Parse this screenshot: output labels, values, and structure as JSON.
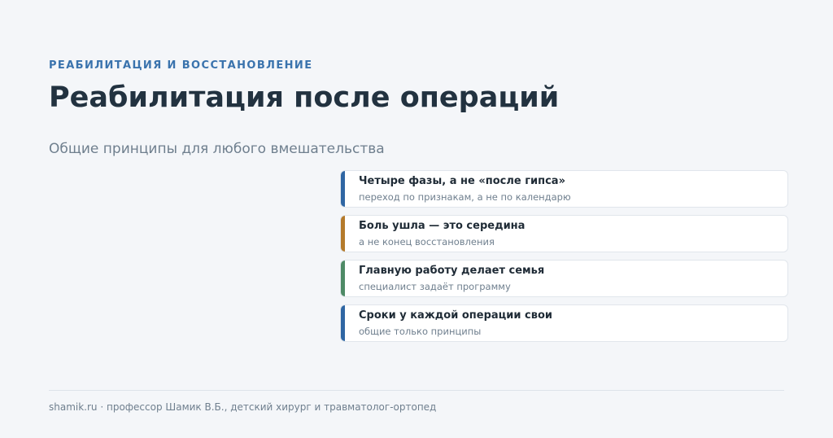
{
  "header": {
    "eyebrow": "РЕАБИЛИТАЦИЯ И ВОССТАНОВЛЕНИЕ",
    "title": "Реабилитация после операций",
    "subtitle": "Общие принципы для любого вмешательства"
  },
  "cards": [
    {
      "title": "Четыре фазы, а не «после гипса»",
      "subtitle": "переход по признакам, а не по календарю",
      "accent": "#2f66a3"
    },
    {
      "title": "Боль ушла — это середина",
      "subtitle": "а не конец восстановления",
      "accent": "#b47a2b"
    },
    {
      "title": "Главную работу делает семья",
      "subtitle": "специалист задаёт программу",
      "accent": "#4e8a66"
    },
    {
      "title": "Сроки у каждой операции свои",
      "subtitle": "общие только принципы",
      "accent": "#2f66a3"
    }
  ],
  "footer": {
    "text": "shamik.ru · профессор Шамик В.Б., детский хирург и травматолог-ортопед"
  }
}
